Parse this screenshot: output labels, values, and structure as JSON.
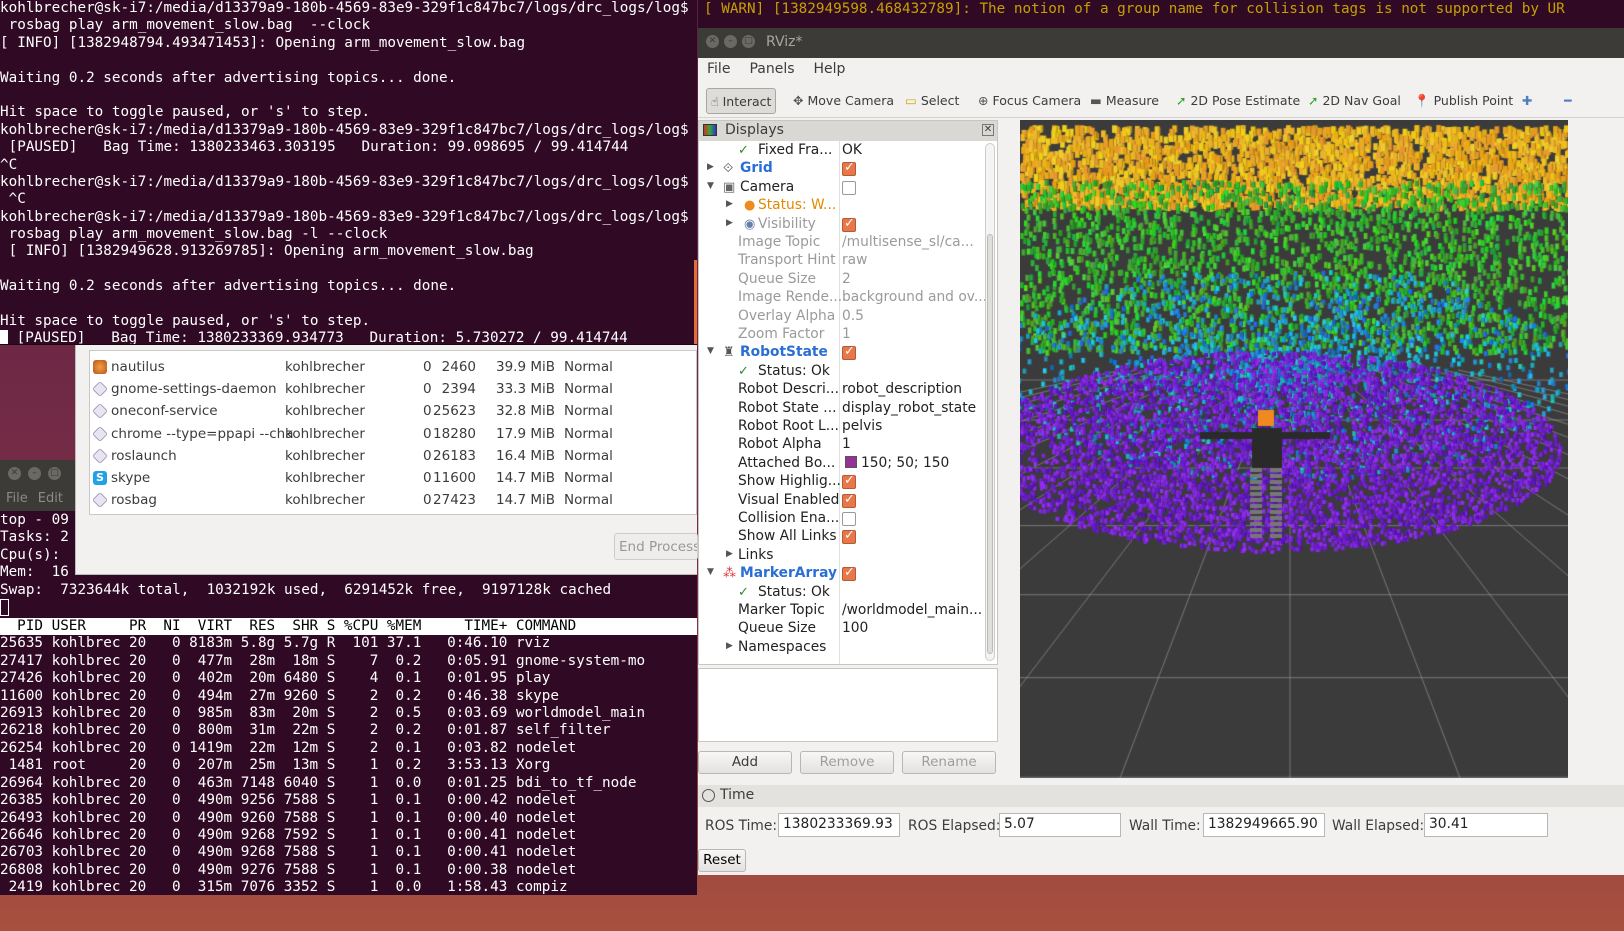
{
  "terminal1": {
    "lines": [
      "kohlbrecher@sk-i7:/media/d13379a9-180b-4569-83e9-329f1c847bc7/logs/drc_logs/log$",
      " rosbag play arm_movement_slow.bag  --clock",
      "[ INFO] [1382948794.493471453]: Opening arm_movement_slow.bag",
      "",
      "Waiting 0.2 seconds after advertising topics... done.",
      "",
      "Hit space to toggle paused, or 's' to step.",
      "kohlbrecher@sk-i7:/media/d13379a9-180b-4569-83e9-329f1c847bc7/logs/drc_logs/log$",
      " [PAUSED]   Bag Time: 1380233463.303195   Duration: 99.098695 / 99.414744",
      "^C",
      "kohlbrecher@sk-i7:/media/d13379a9-180b-4569-83e9-329f1c847bc7/logs/drc_logs/log$",
      " ^C",
      "kohlbrecher@sk-i7:/media/d13379a9-180b-4569-83e9-329f1c847bc7/logs/drc_logs/log$",
      " rosbag play arm_movement_slow.bag -l --clock",
      " [ INFO] [1382949628.913269785]: Opening arm_movement_slow.bag",
      "",
      "Waiting 0.2 seconds after advertising topics... done.",
      "",
      "Hit space to toggle paused, or 's' to step.",
      " [PAUSED]   Bag Time: 1380233369.934773   Duration: 5.730272 / 99.414744"
    ]
  },
  "warn_line": "[ WARN] [1382949598.468432789]: The notion of a group name for collision tags is not supported by UR",
  "terminal2": {
    "menu": [
      "File",
      "Edit"
    ],
    "summary": [
      "top - 09",
      "Tasks: 2",
      "Cpu(s):",
      "Mem:  16",
      "Swap:  7323644k total,  1032192k used,  6291452k free,  9197128k cached"
    ],
    "columns": [
      "PID",
      "USER",
      "PR",
      "NI",
      "VIRT",
      "RES",
      "SHR",
      "S",
      "%CPU",
      "%MEM",
      "TIME+",
      "COMMAND"
    ],
    "rows": [
      [
        "25635",
        "kohlbrec",
        "20",
        "0",
        "8183m",
        "5.8g",
        "5.7g",
        "R",
        "101",
        "37.1",
        "0:46.10",
        "rviz"
      ],
      [
        "27417",
        "kohlbrec",
        "20",
        "0",
        "477m",
        "28m",
        "18m",
        "S",
        "7",
        "0.2",
        "0:05.91",
        "gnome-system-mo"
      ],
      [
        "27426",
        "kohlbrec",
        "20",
        "0",
        "402m",
        "20m",
        "6480",
        "S",
        "4",
        "0.1",
        "0:01.95",
        "play"
      ],
      [
        "11600",
        "kohlbrec",
        "20",
        "0",
        "494m",
        "27m",
        "9260",
        "S",
        "2",
        "0.2",
        "0:46.38",
        "skype"
      ],
      [
        "26913",
        "kohlbrec",
        "20",
        "0",
        "985m",
        "83m",
        "20m",
        "S",
        "2",
        "0.5",
        "0:03.69",
        "worldmodel_main"
      ],
      [
        "26218",
        "kohlbrec",
        "20",
        "0",
        "800m",
        "31m",
        "22m",
        "S",
        "2",
        "0.2",
        "0:01.87",
        "self_filter"
      ],
      [
        "26254",
        "kohlbrec",
        "20",
        "0",
        "1419m",
        "22m",
        "12m",
        "S",
        "2",
        "0.1",
        "0:03.82",
        "nodelet"
      ],
      [
        "1481",
        "root",
        "20",
        "0",
        "207m",
        "25m",
        "13m",
        "S",
        "1",
        "0.2",
        "3:53.13",
        "Xorg"
      ],
      [
        "26964",
        "kohlbrec",
        "20",
        "0",
        "463m",
        "7148",
        "6040",
        "S",
        "1",
        "0.0",
        "0:01.25",
        "bdi_to_tf_node"
      ],
      [
        "26385",
        "kohlbrec",
        "20",
        "0",
        "490m",
        "9256",
        "7588",
        "S",
        "1",
        "0.1",
        "0:00.42",
        "nodelet"
      ],
      [
        "26493",
        "kohlbrec",
        "20",
        "0",
        "490m",
        "9260",
        "7588",
        "S",
        "1",
        "0.1",
        "0:00.40",
        "nodelet"
      ],
      [
        "26646",
        "kohlbrec",
        "20",
        "0",
        "490m",
        "9268",
        "7592",
        "S",
        "1",
        "0.1",
        "0:00.41",
        "nodelet"
      ],
      [
        "26703",
        "kohlbrec",
        "20",
        "0",
        "490m",
        "9268",
        "7588",
        "S",
        "1",
        "0.1",
        "0:00.41",
        "nodelet"
      ],
      [
        "26808",
        "kohlbrec",
        "20",
        "0",
        "490m",
        "9276",
        "7588",
        "S",
        "1",
        "0.1",
        "0:00.38",
        "nodelet"
      ],
      [
        "2419",
        "kohlbrec",
        "20",
        "0",
        "315m",
        "7076",
        "3352",
        "S",
        "1",
        "0.0",
        "1:58.43",
        "compiz"
      ]
    ]
  },
  "system_monitor": {
    "processes": [
      {
        "icon": "nautilus-icon",
        "name": "nautilus",
        "user": "kohlbrecher",
        "nice": "0",
        "id": "2460",
        "memory": "39.9 MiB",
        "priority": "Normal"
      },
      {
        "icon": "generic-process-icon",
        "name": "gnome-settings-daemon",
        "user": "kohlbrecher",
        "nice": "0",
        "id": "2394",
        "memory": "33.3 MiB",
        "priority": "Normal"
      },
      {
        "icon": "generic-process-icon",
        "name": "oneconf-service",
        "user": "kohlbrecher",
        "nice": "0",
        "id": "25623",
        "memory": "32.8 MiB",
        "priority": "Normal"
      },
      {
        "icon": "generic-process-icon",
        "name": "chrome --type=ppapi --cha",
        "user": "kohlbrecher",
        "nice": "0",
        "id": "18280",
        "memory": "17.9 MiB",
        "priority": "Normal"
      },
      {
        "icon": "generic-process-icon",
        "name": "roslaunch",
        "user": "kohlbrecher",
        "nice": "0",
        "id": "26183",
        "memory": "16.4 MiB",
        "priority": "Normal"
      },
      {
        "icon": "skype-icon",
        "name": "skype",
        "user": "kohlbrecher",
        "nice": "0",
        "id": "11600",
        "memory": "14.7 MiB",
        "priority": "Normal"
      },
      {
        "icon": "generic-process-icon",
        "name": "rosbag",
        "user": "kohlbrecher",
        "nice": "0",
        "id": "27423",
        "memory": "14.7 MiB",
        "priority": "Normal"
      }
    ],
    "end_process_label": "End Process"
  },
  "rviz": {
    "title": "RViz*",
    "menu": [
      "File",
      "Panels",
      "Help"
    ],
    "tools": [
      {
        "label": "Interact",
        "icon": "cursor-icon",
        "active": true
      },
      {
        "label": "Move Camera",
        "icon": "move-icon"
      },
      {
        "label": "Select",
        "icon": "select-box-icon"
      },
      {
        "label": "Focus Camera",
        "icon": "focus-icon"
      },
      {
        "label": "Measure",
        "icon": "ruler-icon"
      },
      {
        "label": "2D Pose Estimate",
        "icon": "green-arrow-icon"
      },
      {
        "label": "2D Nav Goal",
        "icon": "green-arrow-icon"
      },
      {
        "label": "Publish Point",
        "icon": "map-pin-icon"
      },
      {
        "label": "",
        "icon": "plus-icon"
      },
      {
        "label": "",
        "icon": "minus-icon"
      }
    ],
    "displays": {
      "title": "Displays",
      "rows": [
        {
          "depth": 1,
          "label": "Fixed Fra...",
          "value": "OK",
          "icon": "check-icon",
          "style": "normal"
        },
        {
          "depth": 0,
          "label": "Grid",
          "checked": true,
          "icon": "grid-icon",
          "arrow": "collapsed",
          "style": "display"
        },
        {
          "depth": 0,
          "label": "Camera",
          "checked": false,
          "icon": "camera-icon",
          "arrow": "expanded",
          "style": "normal"
        },
        {
          "depth": 1,
          "label": "Status: W...",
          "icon": "warning-icon",
          "arrow": "collapsed",
          "style": "warn"
        },
        {
          "depth": 1,
          "label": "Visibility",
          "checked": true,
          "icon": "eye-icon",
          "arrow": "collapsed",
          "style": "disabled"
        },
        {
          "depth": 1,
          "label": "Image Topic",
          "value": "/multisense_sl/ca...",
          "style": "disabled"
        },
        {
          "depth": 1,
          "label": "Transport Hint",
          "value": "raw",
          "style": "disabled"
        },
        {
          "depth": 1,
          "label": "Queue Size",
          "value": "2",
          "style": "disabled"
        },
        {
          "depth": 1,
          "label": "Image Rende...",
          "value": "background and ov...",
          "style": "disabled"
        },
        {
          "depth": 1,
          "label": "Overlay Alpha",
          "value": "0.5",
          "style": "disabled"
        },
        {
          "depth": 1,
          "label": "Zoom Factor",
          "value": "1",
          "style": "disabled"
        },
        {
          "depth": 0,
          "label": "RobotState",
          "checked": true,
          "icon": "robot-icon",
          "arrow": "expanded",
          "style": "display"
        },
        {
          "depth": 1,
          "label": "Status: Ok",
          "icon": "check-icon",
          "style": "normal"
        },
        {
          "depth": 1,
          "label": "Robot Descri...",
          "value": "robot_description",
          "style": "normal"
        },
        {
          "depth": 1,
          "label": "Robot State ...",
          "value": "display_robot_state",
          "style": "normal"
        },
        {
          "depth": 1,
          "label": "Robot Root L...",
          "value": "pelvis",
          "style": "normal"
        },
        {
          "depth": 1,
          "label": "Robot Alpha",
          "value": "1",
          "style": "normal"
        },
        {
          "depth": 1,
          "label": "Attached Bo...",
          "value": "150; 50; 150",
          "swatch": "#963296",
          "style": "normal"
        },
        {
          "depth": 1,
          "label": "Show Highlig...",
          "checked": true,
          "style": "normal"
        },
        {
          "depth": 1,
          "label": "Visual Enabled",
          "checked": true,
          "style": "normal"
        },
        {
          "depth": 1,
          "label": "Collision Ena...",
          "checked": false,
          "style": "normal"
        },
        {
          "depth": 1,
          "label": "Show All Links",
          "checked": true,
          "style": "normal"
        },
        {
          "depth": 1,
          "label": "Links",
          "arrow": "collapsed",
          "style": "normal"
        },
        {
          "depth": 0,
          "label": "MarkerArray",
          "checked": true,
          "icon": "marker-array-icon",
          "arrow": "expanded",
          "style": "display"
        },
        {
          "depth": 1,
          "label": "Status: Ok",
          "icon": "check-icon",
          "style": "normal"
        },
        {
          "depth": 1,
          "label": "Marker Topic",
          "value": "/worldmodel_main...",
          "style": "normal"
        },
        {
          "depth": 1,
          "label": "Queue Size",
          "value": "100",
          "style": "normal"
        },
        {
          "depth": 1,
          "label": "Namespaces",
          "arrow": "collapsed",
          "style": "normal"
        }
      ]
    },
    "buttons": {
      "add": "Add",
      "remove": "Remove",
      "rename": "Rename"
    },
    "time": {
      "title": "Time",
      "ros_time_label": "ROS Time:",
      "ros_time": "1380233369.93",
      "ros_elapsed_label": "ROS Elapsed:",
      "ros_elapsed": "5.07",
      "wall_time_label": "Wall Time:",
      "wall_time": "1382949665.90",
      "wall_elapsed_label": "Wall Elapsed:",
      "wall_elapsed": "30.41",
      "reset_label": "Reset"
    }
  },
  "colors": {
    "terminal_bg": "#300a24",
    "warn": "#c4a000",
    "checkbox": "#e8774a",
    "display_name": "#2a6fd6",
    "warning": "#e08a00"
  }
}
